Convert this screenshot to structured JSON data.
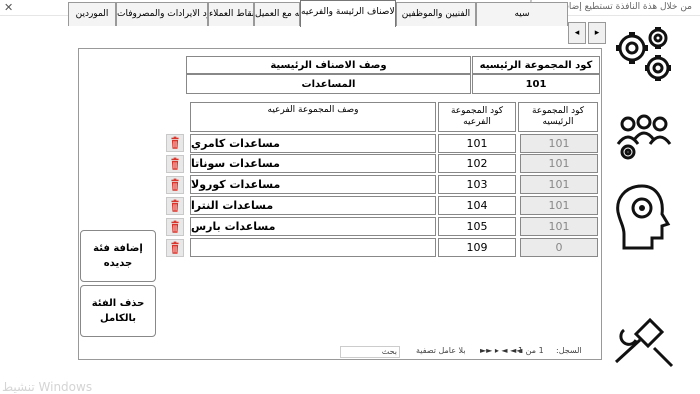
{
  "window": {
    "title": "من خلال هذة النافذة تستطيع إضافة بيانات أو تحديث بيانات سابقة موجودة على النظام"
  },
  "tabs": [
    {
      "label": "الموردين"
    },
    {
      "label": "بنود الايرادات والمصروفات"
    },
    {
      "label": "نقاط العملاء"
    },
    {
      "label": "شروط الاتفاقيه مع العميل"
    },
    {
      "label": "انواع الاصناف الرئيسة والفرعيه"
    },
    {
      "label": "الفنيين والموظفين"
    },
    {
      "label": "سيه"
    }
  ],
  "main_group": {
    "code_header": "كود المجموعة الرئيسيه",
    "desc_header": "وصف الاصناف الرئيسية",
    "code_value": "101",
    "desc_value": "المساعدات"
  },
  "sub_table": {
    "headers": {
      "main_code": "كود المجموعة الرئيسيه",
      "sub_code": "كود المجموعة الفرعيه",
      "sub_desc": "وصف المجموعة الفرعيه"
    },
    "rows": [
      {
        "main_code": "101",
        "sub_code": "101",
        "sub_desc": "مساعدات كامري"
      },
      {
        "main_code": "101",
        "sub_code": "102",
        "sub_desc": "مساعدات سوناتا"
      },
      {
        "main_code": "101",
        "sub_code": "103",
        "sub_desc": "مساعدات كورولا"
      },
      {
        "main_code": "101",
        "sub_code": "104",
        "sub_desc": "مساعدات النترا"
      },
      {
        "main_code": "101",
        "sub_code": "105",
        "sub_desc": "مساعدات بارس"
      },
      {
        "main_code": "0",
        "sub_code": "109",
        "sub_desc": ""
      }
    ]
  },
  "buttons": {
    "add_category": "إضافة فئة جديده",
    "delete_category": "حذف الفئة بالكامل"
  },
  "record_nav": {
    "label": "السجل:",
    "position": "1 من 1",
    "filter": "بلا عامل تصفية",
    "search": "بحث"
  },
  "side_icons": [
    "gears-icon",
    "team-settings-icon",
    "brain-gear-icon",
    "tools-icon"
  ],
  "watermark": "تنشيط Windows",
  "colors": {
    "trash": "#d9342b",
    "gray_cell": "#ebebeb"
  }
}
